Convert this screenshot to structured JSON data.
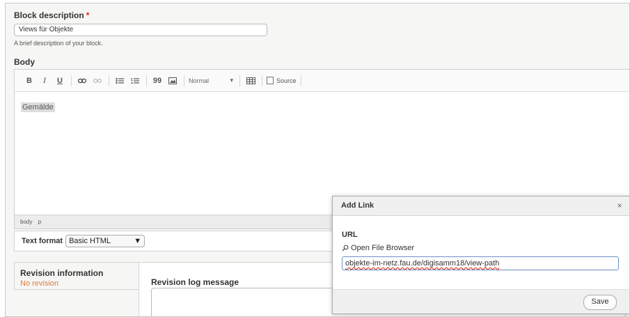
{
  "block_description": {
    "label": "Block description",
    "required_mark": "*",
    "value": "Views für Objekte",
    "help": "A brief description of your block."
  },
  "body": {
    "label": "Body",
    "toolbar": {
      "bold": "B",
      "italic": "I",
      "underline": "U",
      "blockquote": "99",
      "format_value": "Normal",
      "source_label": "Source"
    },
    "content_text": "Gemälde",
    "path": [
      "body",
      "p"
    ]
  },
  "text_format": {
    "label": "Text format",
    "selected": "Basic HTML"
  },
  "revision": {
    "tab_title": "Revision information",
    "tab_summary": "No revision",
    "log_label": "Revision log message"
  },
  "dialog": {
    "title": "Add Link",
    "close": "×",
    "url_label": "URL",
    "file_browser": "Open File Browser",
    "url_value": "objekte-im-netz.fau.de/digisamm18/view-path",
    "save": "Save"
  },
  "colors": {
    "required": "#e62600",
    "revision_summary": "#e07b3a",
    "input_focus": "#6d8fc6"
  }
}
